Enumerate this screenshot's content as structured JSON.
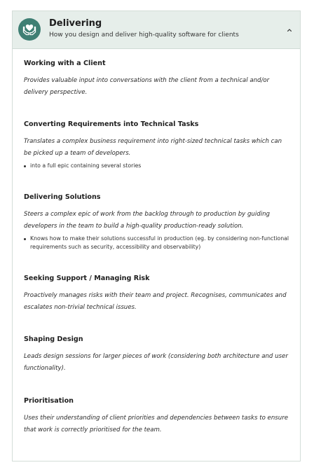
{
  "header": {
    "icon": "heart-hands-icon",
    "title": "Delivering",
    "subtitle": "How you design and deliver high-quality software for clients",
    "toggle_icon": "chevron-up-icon"
  },
  "colors": {
    "header_bg": "#e6eeea",
    "icon_bg": "#3f7f74",
    "border": "#d3ddd8"
  },
  "sections": [
    {
      "title": "Working with a Client",
      "description": "Provides valuable input into conversations with the client from a technical and/or delivery perspective.",
      "items": []
    },
    {
      "title": "Converting Requirements into Technical Tasks",
      "description": "Translates a complex business requirement into right-sized technical tasks which can be picked up a team of developers.",
      "items": [
        "into a full epic containing several stories"
      ]
    },
    {
      "title": "Delivering Solutions",
      "description": "Steers a complex epic of work from the backlog through to production by guiding developers in the team to build a high-quality production-ready solution.",
      "items": [
        "Knows how to make their solutions successful in production (eg. by considering non-functional requirements such as security, accessibility and observability)"
      ]
    },
    {
      "title": "Seeking Support / Managing Risk",
      "description": "Proactively manages risks with their team and project. Recognises, communicates and escalates non-trivial technical issues.",
      "items": []
    },
    {
      "title": "Shaping Design",
      "description": "Leads design sessions for larger pieces of work (considering both architecture and user functionality).",
      "items": []
    },
    {
      "title": "Prioritisation",
      "description": "Uses their understanding of client priorities and dependencies between tasks to ensure that work is correctly prioritised for the team.",
      "items": []
    }
  ]
}
